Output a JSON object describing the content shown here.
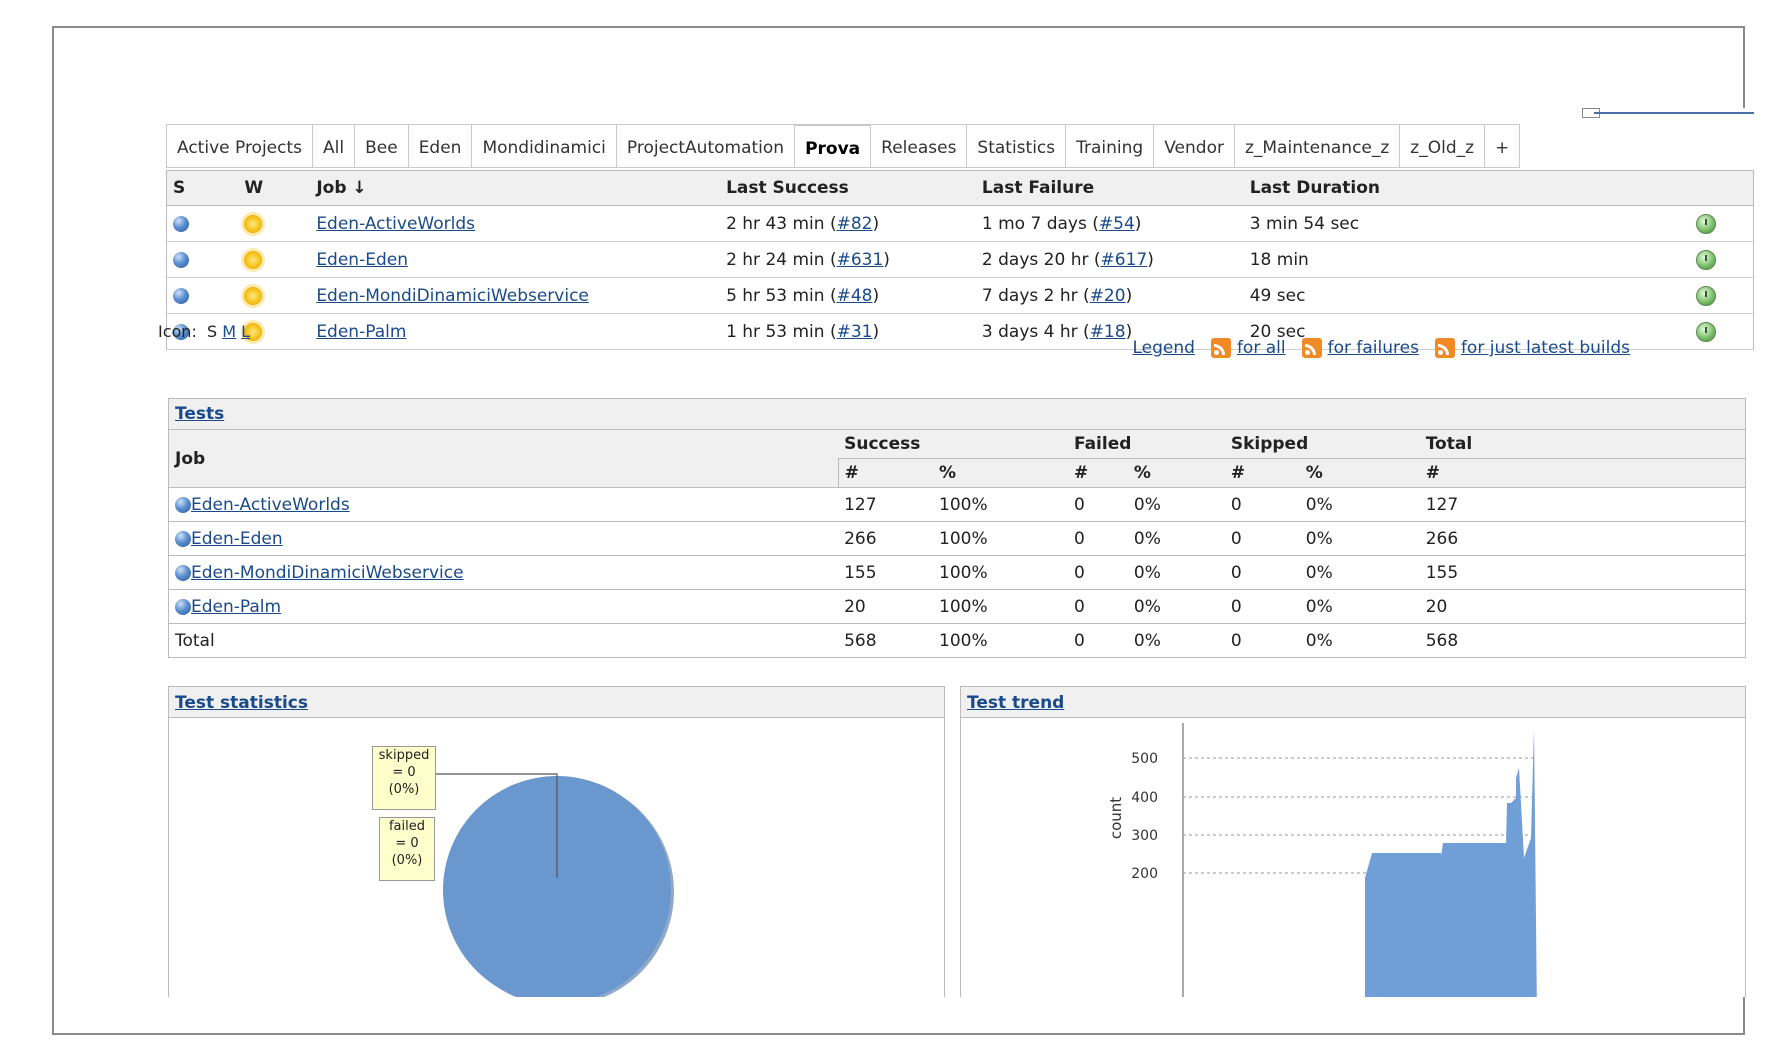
{
  "tabs": [
    "Active Projects",
    "All",
    "Bee",
    "Eden",
    "Mondidinamici",
    "ProjectAutomation",
    "Prova",
    "Releases",
    "Statistics",
    "Training",
    "Vendor",
    "z_Maintenance_z",
    "z_Old_z",
    "+"
  ],
  "active_tab": "Prova",
  "jobs_table": {
    "headers": {
      "s": "S",
      "w": "W",
      "job": "Job ↓",
      "last_success": "Last Success",
      "last_failure": "Last Failure",
      "last_duration": "Last Duration"
    },
    "rows": [
      {
        "job": "Eden-ActiveWorlds",
        "succ_text": "2 hr 43 min",
        "succ_build": "#82",
        "fail_text": "1 mo 7 days",
        "fail_build": "#54",
        "duration": "3 min 54 sec"
      },
      {
        "job": "Eden-Eden",
        "succ_text": "2 hr 24 min",
        "succ_build": "#631",
        "fail_text": "2 days 20 hr",
        "fail_build": "#617",
        "duration": "18 min"
      },
      {
        "job": "Eden-MondiDinamiciWebservice",
        "succ_text": "5 hr 53 min",
        "succ_build": "#48",
        "fail_text": "7 days 2 hr",
        "fail_build": "#20",
        "duration": "49 sec"
      },
      {
        "job": "Eden-Palm",
        "succ_text": "1 hr 53 min",
        "succ_build": "#31",
        "fail_text": "3 days 4 hr",
        "fail_build": "#18",
        "duration": "20 sec"
      }
    ]
  },
  "icon_size": {
    "label": "Icon:",
    "s": "S",
    "m": "M",
    "l": "L"
  },
  "feeds": {
    "legend": "Legend",
    "all": "for all",
    "failures": "for failures",
    "latest": "for just latest builds"
  },
  "tests": {
    "title": "Tests",
    "headers": {
      "job": "Job",
      "success": "Success",
      "failed": "Failed",
      "skipped": "Skipped",
      "total": "Total",
      "count": "#",
      "pct": "%"
    },
    "rows": [
      {
        "job": "Eden-ActiveWorlds",
        "succ": "127",
        "succ_pct": "100%",
        "fail": "0",
        "fail_pct": "0%",
        "skip": "0",
        "skip_pct": "0%",
        "total": "127"
      },
      {
        "job": "Eden-Eden",
        "succ": "266",
        "succ_pct": "100%",
        "fail": "0",
        "fail_pct": "0%",
        "skip": "0",
        "skip_pct": "0%",
        "total": "266"
      },
      {
        "job": "Eden-MondiDinamiciWebservice",
        "succ": "155",
        "succ_pct": "100%",
        "fail": "0",
        "fail_pct": "0%",
        "skip": "0",
        "skip_pct": "0%",
        "total": "155"
      },
      {
        "job": "Eden-Palm",
        "succ": "20",
        "succ_pct": "100%",
        "fail": "0",
        "fail_pct": "0%",
        "skip": "0",
        "skip_pct": "0%",
        "total": "20"
      }
    ],
    "total_row": {
      "job": "Total",
      "succ": "568",
      "succ_pct": "100%",
      "fail": "0",
      "fail_pct": "0%",
      "skip": "0",
      "skip_pct": "0%",
      "total": "568"
    }
  },
  "test_statistics": {
    "title": "Test statistics",
    "callouts": [
      {
        "l1": "skipped",
        "l2": "= 0",
        "l3": "(0%)"
      },
      {
        "l1": "failed",
        "l2": "= 0",
        "l3": "(0%)"
      }
    ]
  },
  "test_trend": {
    "title": "Test trend",
    "ylabel": "count",
    "yticks": [
      "500",
      "400",
      "300",
      "200"
    ]
  },
  "colors": {
    "link": "#1a4a8a",
    "header_bg": "#f0f0f0",
    "chart_fill": "#6f9fd6"
  }
}
